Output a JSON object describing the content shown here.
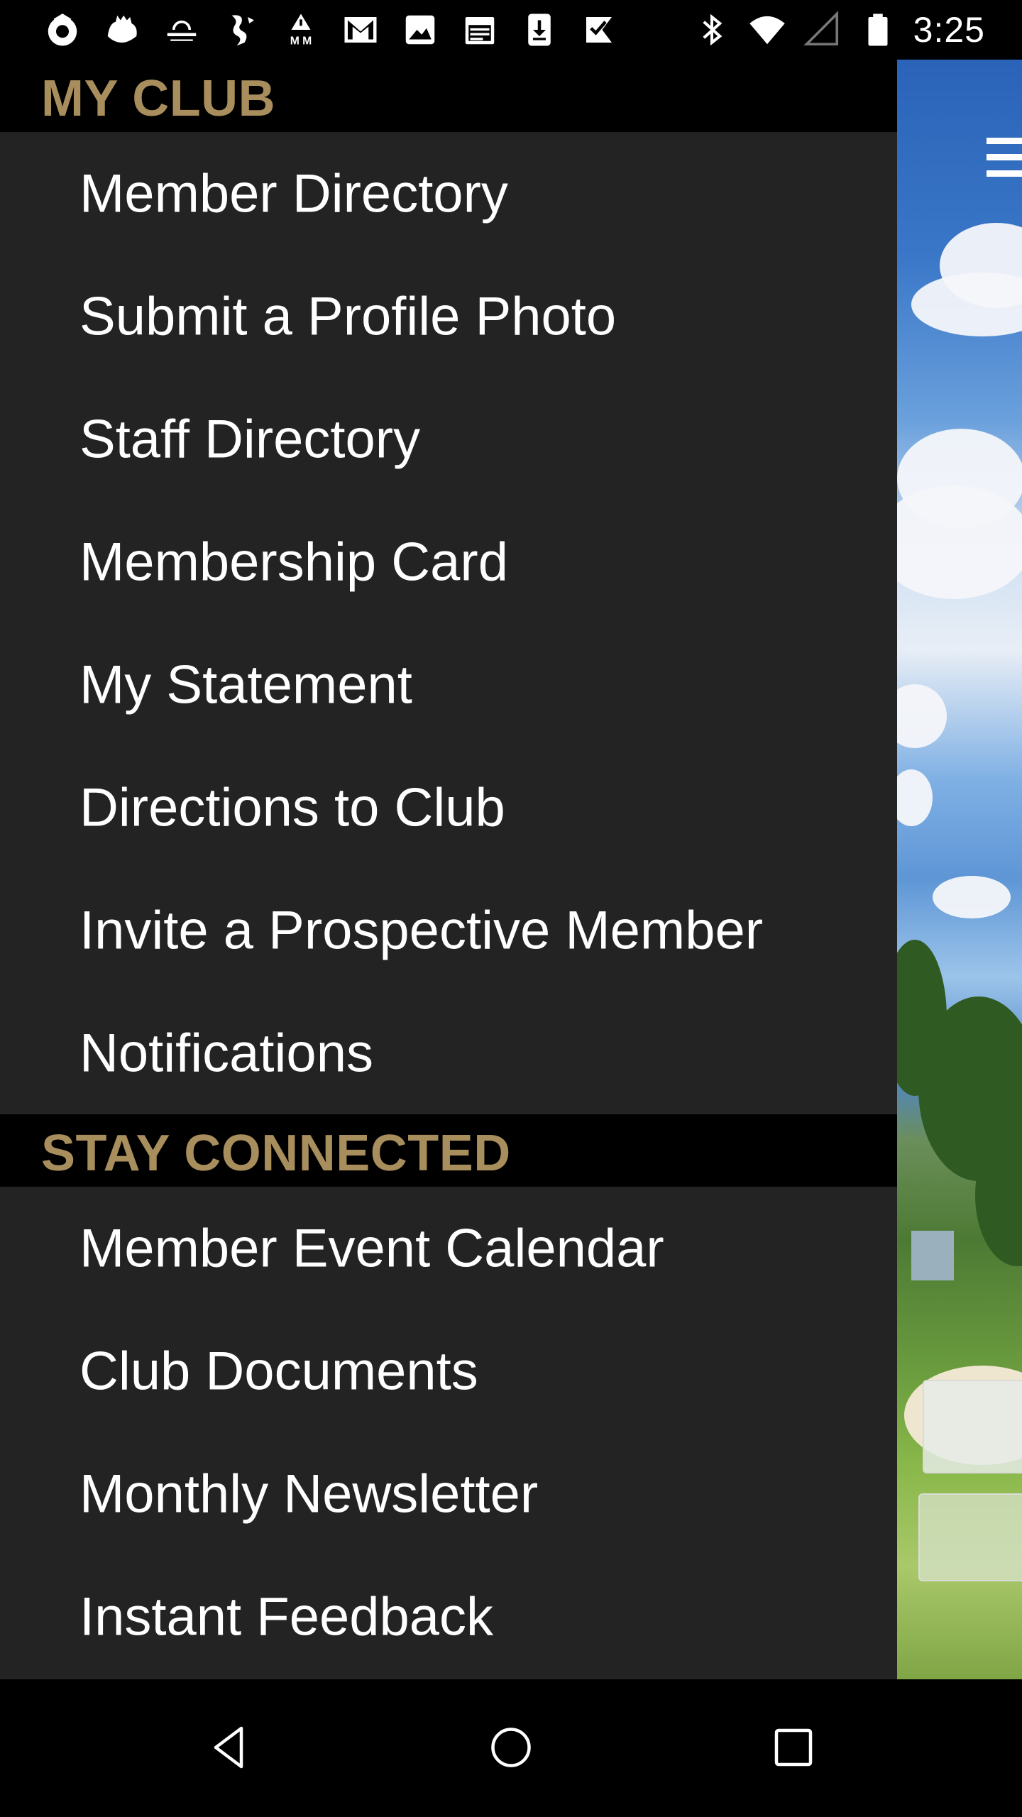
{
  "status_bar": {
    "time": "3:25",
    "notification_icons": [
      "crest-icon",
      "lion-crest-icon",
      "ballenisles-logo-icon",
      "dragon-icon",
      "alert-mm-icon",
      "gmail-icon",
      "photo-icon",
      "calendar-icon",
      "download-icon",
      "check-icon"
    ],
    "system_icons": [
      "bluetooth-icon",
      "wifi-icon",
      "signal-icon",
      "battery-icon"
    ]
  },
  "drawer": {
    "sections": [
      {
        "title": "MY CLUB",
        "items": [
          {
            "label": "Member Directory"
          },
          {
            "label": "Submit a Profile Photo"
          },
          {
            "label": "Staff Directory"
          },
          {
            "label": "Membership Card"
          },
          {
            "label": "My Statement"
          },
          {
            "label": "Directions to Club"
          },
          {
            "label": "Invite a Prospective Member"
          },
          {
            "label": "Notifications"
          }
        ]
      },
      {
        "title": "STAY CONNECTED",
        "items": [
          {
            "label": "Member Event Calendar"
          },
          {
            "label": "Club Documents"
          },
          {
            "label": "Monthly Newsletter"
          },
          {
            "label": "Instant Feedback"
          }
        ]
      }
    ]
  },
  "colors": {
    "section_title": "#a98e5d",
    "drawer_bg": "#232324",
    "section_header_bg": "#000000",
    "item_text": "#ffffff"
  },
  "nav_bar": {
    "buttons": [
      "back-icon",
      "home-icon",
      "recents-icon"
    ]
  }
}
